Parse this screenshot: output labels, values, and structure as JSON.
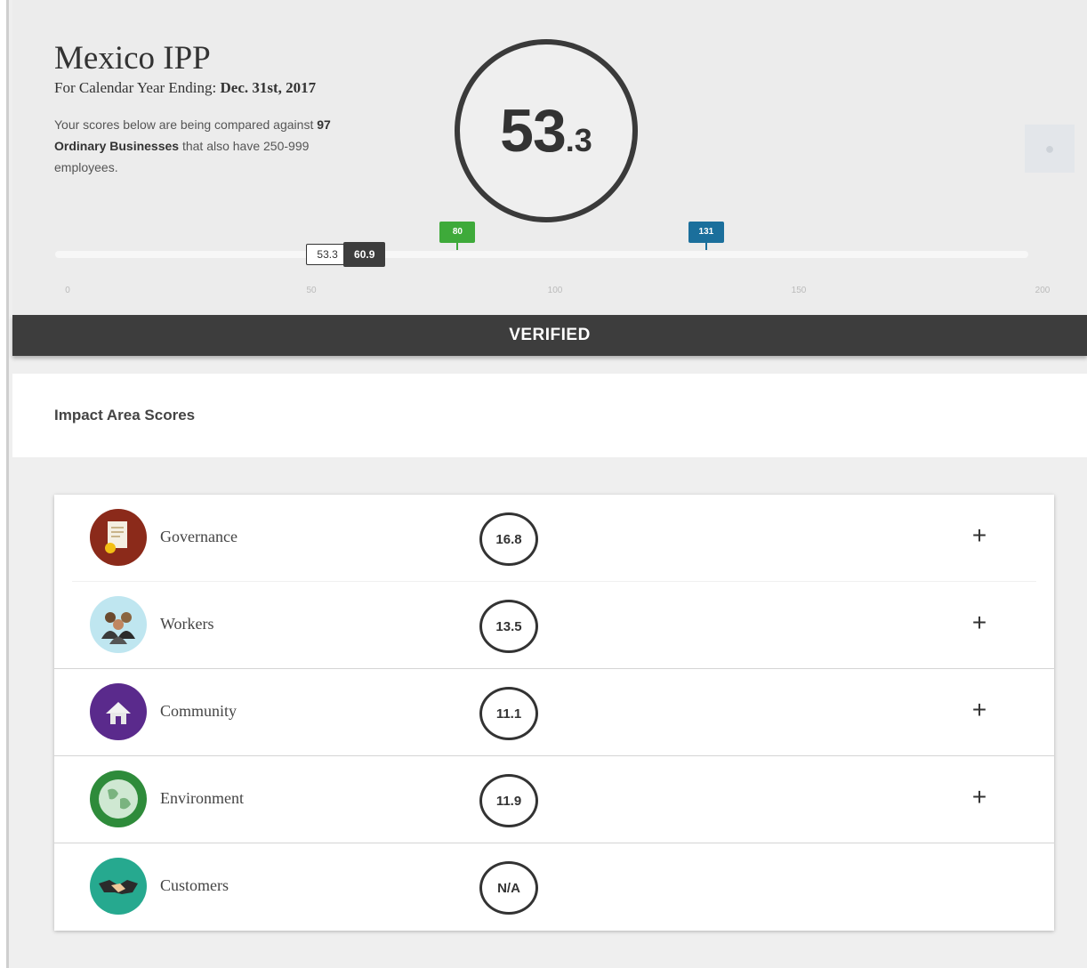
{
  "header": {
    "company": "Mexico IPP",
    "period_prefix": "For Calendar Year Ending: ",
    "period_date": "Dec. 31st, 2017",
    "compare_prefix": "Your scores below are being compared against ",
    "compare_group": "97 Ordinary Businesses",
    "compare_suffix": " that also have 250-999 employees."
  },
  "overall_score": {
    "whole": "53",
    "decimal": ".3",
    "value": 53.3
  },
  "scale": {
    "min": 0,
    "max": 200,
    "ticks": [
      "0",
      "50",
      "100",
      "150",
      "200"
    ],
    "your_score": {
      "label": "53.3",
      "value": 53.3
    },
    "median": {
      "label": "60.9",
      "value": 60.9
    },
    "certification_threshold": {
      "label": "80",
      "value": 80
    },
    "top_score": {
      "label": "131",
      "value": 131
    }
  },
  "status": {
    "label": "VERIFIED"
  },
  "impact_section": {
    "title": "Impact Area Scores",
    "areas": [
      {
        "name": "Governance",
        "score": "16.8",
        "icon": "governance-icon",
        "color": "#8b2a1a",
        "expandable": true
      },
      {
        "name": "Workers",
        "score": "13.5",
        "icon": "workers-icon",
        "color": "#4cb8d4",
        "expandable": true
      },
      {
        "name": "Community",
        "score": "11.1",
        "icon": "community-icon",
        "color": "#5a2a8c",
        "expandable": true
      },
      {
        "name": "Environment",
        "score": "11.9",
        "icon": "environment-icon",
        "color": "#2e8b3a",
        "expandable": true
      },
      {
        "name": "Customers",
        "score": "N/A",
        "icon": "customers-icon",
        "color": "#26a98f",
        "expandable": false
      }
    ],
    "expand_symbol": "+"
  },
  "colors": {
    "yellow_range": "#f3c014",
    "green_flag": "#3eaa3a",
    "blue_flag": "#1b6f9c",
    "dark": "#3d3d3d"
  }
}
